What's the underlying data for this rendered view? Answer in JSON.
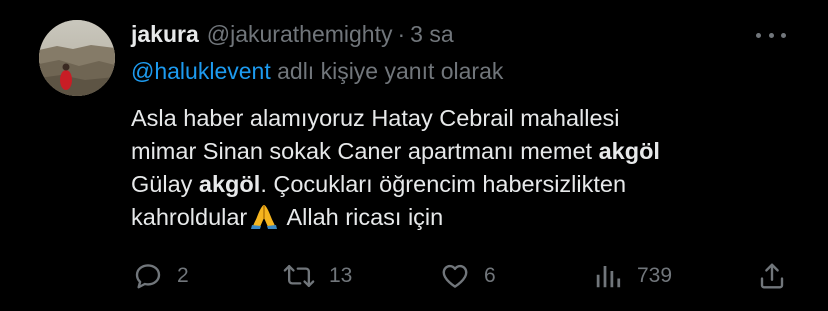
{
  "tweet": {
    "display_name": "jakura",
    "handle": "@jakurathemighty",
    "separator": "·",
    "time": "3 sa",
    "reply_mention": "@haluklevent",
    "reply_suffix": " adlı kişiye yanıt olarak",
    "body": {
      "line1": "Asla haber alamıyoruz Hatay Cebrail mahallesi",
      "line2_pre": "mimar Sinan sokak Caner apartmanı memet ",
      "line2_bold": "akgöl",
      "line3_pre": "Gülay ",
      "line3_bold": "akgöl",
      "line3_post": ". Çocukları öğrencim habersizlikten",
      "line4_pre": "kahroldular",
      "line4_post": "Allah ricası için",
      "emoji": "folded-hands-emoji"
    },
    "actions": {
      "reply_count": "2",
      "retweet_count": "13",
      "like_count": "6",
      "views_count": "739"
    }
  },
  "colors": {
    "background": "#000000",
    "text": "#e7e9ea",
    "muted": "#71767b",
    "link": "#1d9bf0"
  },
  "icons": [
    "more-icon",
    "reply-icon",
    "retweet-icon",
    "like-icon",
    "views-icon",
    "share-icon"
  ]
}
